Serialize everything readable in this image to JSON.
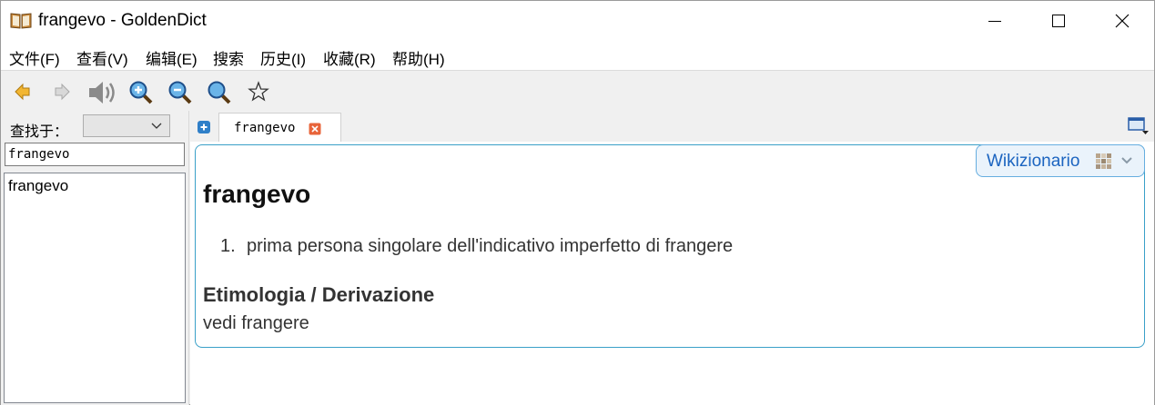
{
  "window": {
    "title": "frangevo - GoldenDict",
    "icon": "book-icon",
    "controls": [
      "minimize-icon",
      "maximize-icon",
      "close-icon"
    ]
  },
  "menu": {
    "items": [
      "文件(F)",
      "查看(V)",
      "编辑(E)",
      "搜索",
      "历史(I)",
      "收藏(R)",
      "帮助(H)"
    ]
  },
  "toolbar": {
    "buttons": [
      "back-arrow-icon",
      "forward-arrow-icon",
      "speaker-icon",
      "zoom-in-icon",
      "zoom-out-icon",
      "zoom-reset-icon",
      "favorite-star-icon"
    ]
  },
  "left": {
    "lookin_label": "查找于：",
    "lookin_value": "",
    "search_value": "frangevo",
    "words": [
      "frangevo"
    ]
  },
  "tabs": [
    {
      "label": "frangevo"
    }
  ],
  "article": {
    "dictionary": "Wikizionario",
    "headword": "frangevo",
    "definitions": [
      {
        "num": "1.",
        "text": "prima persona singolare dell'indicativo imperfetto di frangere"
      }
    ],
    "section_title": "Etimologia / Derivazione",
    "section_text": "vedi frangere"
  },
  "colors": {
    "accent": "#3aa0c8",
    "dict_tag_text": "#1b64c0",
    "dict_tag_bg": "#eaf3fb"
  }
}
